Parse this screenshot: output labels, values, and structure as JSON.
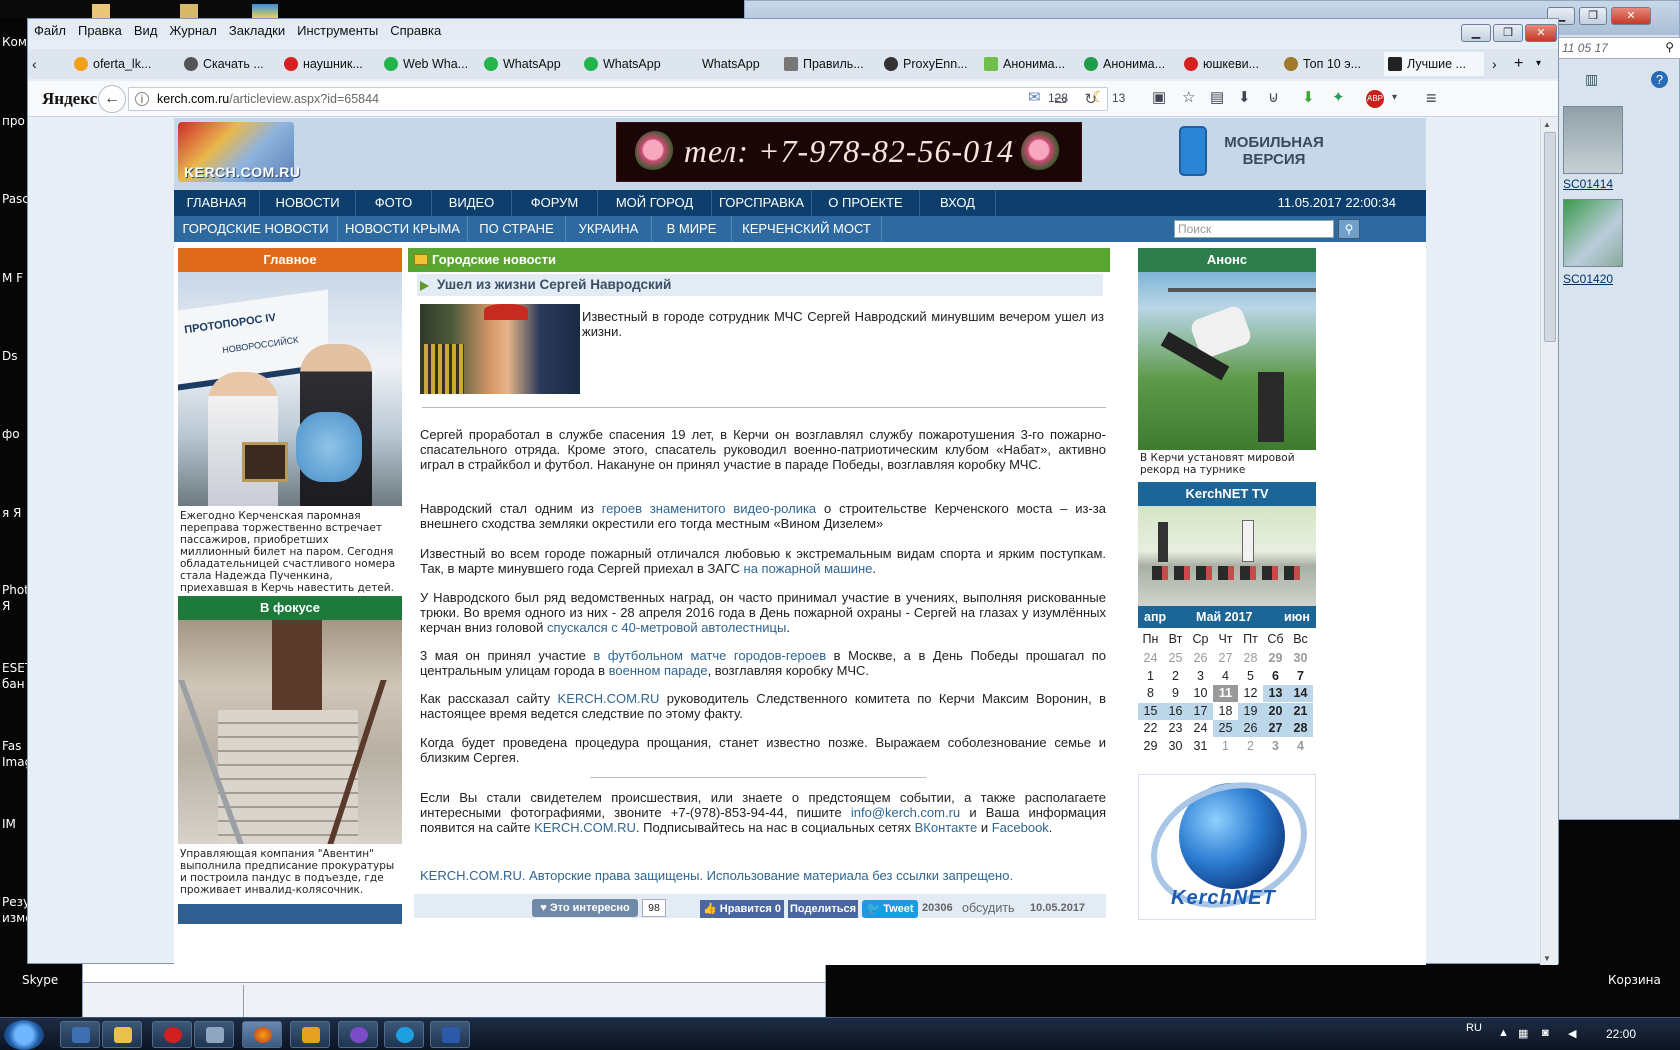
{
  "desktop": {
    "left_icons": [
      "Ком",
      "про",
      "Pasc",
      "М F",
      "Ds",
      "фо",
      "я Я",
      "Phot Я",
      "ESET бан",
      "Fas Imag",
      "IM",
      "Резу изме"
    ],
    "skype_label": "Skype",
    "recycle_label": "Корзина",
    "right_window": {
      "date_text": "11 05 17",
      "thumb1_caption": "SC01414",
      "thumb2_caption": "SC01420"
    }
  },
  "browser": {
    "menu": [
      "Файл",
      "Правка",
      "Вид",
      "Журнал",
      "Закладки",
      "Инструменты",
      "Справка"
    ],
    "tabs": [
      {
        "label": "oferta_lk...",
        "icon_color": "#f2a01a"
      },
      {
        "label": "Скачать ...",
        "icon_color": "#555555"
      },
      {
        "label": "наушник...",
        "icon_color": "#d62020"
      },
      {
        "label": "Web Wha...",
        "icon_color": "#25b34b"
      },
      {
        "label": "WhatsApp",
        "icon_color": "#25b34b"
      },
      {
        "label": "WhatsApp",
        "icon_color": "#25b34b"
      },
      {
        "label": "WhatsApp",
        "icon_color": "#dde5ef"
      },
      {
        "label": "Правиль...",
        "icon_color": "#777777"
      },
      {
        "label": "ProxyEnn...",
        "icon_color": "#333333"
      },
      {
        "label": "Анонима...",
        "icon_color": "#6fbf4a"
      },
      {
        "label": "Анонима...",
        "icon_color": "#1f9d4a"
      },
      {
        "label": "юшкеви...",
        "icon_color": "#d62020"
      },
      {
        "label": "Топ 10 э...",
        "icon_color": "#a07a2a"
      },
      {
        "label": "Лучшие ...",
        "icon_color": "#222222"
      }
    ],
    "yandex_logo": "Яндекс",
    "url_host": "kerch.com.ru",
    "url_path": "/articleview.aspx?id=65844",
    "mail_count": "128",
    "weather_count": "13"
  },
  "site": {
    "logo_text": "KERCH.COM.RU",
    "phone_banner": "тел: +7-978-82-56-014",
    "mobile_line1": "МОБИЛЬНАЯ",
    "mobile_line2": "ВЕРСИЯ",
    "nav1": [
      "ГЛАВНАЯ",
      "НОВОСТИ",
      "ФОТО",
      "ВИДЕО",
      "ФОРУМ",
      "МОЙ ГОРОД",
      "ГОРСПРАВКА",
      "О ПРОЕКТЕ",
      "ВХОД"
    ],
    "datetime": "11.05.2017 22:00:34",
    "nav2": [
      "ГОРОДСКИЕ НОВОСТИ",
      "НОВОСТИ КРЫМА",
      "ПО СТРАНЕ",
      "УКРАИНА",
      "В МИРЕ",
      "КЕРЧЕНСКИЙ МОСТ"
    ],
    "search_placeholder": "Поиск",
    "left": {
      "main_title": "Главное",
      "main_caption": "Ежегодно Керченская паромная переправа торжественно встречает пассажиров, приобретших миллионный билет на паром. Сегодня обладательницей счастливого номера стала Надежда Пученкина, приехавшая в Керчь навестить детей.",
      "focus_title": "В фокусе",
      "focus_caption": "Управляющая компания \"Авентин\" выполнила предписание прокуратуры и построила пандус в подъезде, где проживает инвалид-колясочник.",
      "ship_text": "ПРОТОПОРОС IV",
      "ship_sub": "НОВОРОССИЙСК"
    },
    "article": {
      "section": "Городские новости",
      "title": "Ушел из жизни Сергей Навродский",
      "lead": "Известный в городе сотрудник МЧС Сергей Навродский минувшим вечером ушел из жизни.",
      "p1": "Сергей проработал в службе спасения 19 лет, в Керчи он возглавлял службу пожаротушения 3-го пожарно-спасательного отряда. Кроме этого, спасатель руководил военно-патриотическим клубом «Набат», активно играл в страйкбол и футбол.  Накануне он принял участие в параде Победы, возглавляя коробку МЧС.",
      "p2a": "Навродский стал одним из ",
      "p2link": "героев знаменитого видео-ролика",
      "p2b": " о строительстве Керченского моста – из-за внешнего сходства земляки окрестили его тогда местным «Вином Дизелем»",
      "p3a": "Известный во всем городе пожарный отличался любовью к экстремальным видам спорта и ярким поступкам. Так, в марте минувшего года Сергей приехал в ЗАГС ",
      "p3link": "на пожарной машине",
      "p3b": ".",
      "p4a": "У Навродского был ряд ведомственных наград, он часто принимал участие в учениях, выполняя рискованные трюки. Во время одного из них - 28 апреля 2016 года в День пожарной охраны - Сергей на глазах у изумлённых керчан вниз головой ",
      "p4link": "спускался с 40-метровой автолестницы",
      "p4b": ".",
      "p5a": "3 мая он принял участие ",
      "p5link1": "в футбольном матче городов-героев",
      "p5b": " в Москве, а в День Победы прошагал по центральным улицам города в ",
      "p5link2": "военном параде",
      "p5c": ", возглавляя коробку МЧС.",
      "p6a": "Как рассказал сайту ",
      "p6link": "KERCH.COM.RU",
      "p6b": " руководитель Следственного комитета по Керчи Максим Воронин, в настоящее время ведется следствие по этому факту.",
      "p7": "Когда будет проведена процедура прощания, станет известно позже. Выражаем соболезнование семье и близким Сергея.",
      "p8a": "Если Вы стали свидетелем происшествия, или знаете о предстоящем событии, а также располагаете интересными фотографиями, звоните +7-(978)-853-94-44, пишите ",
      "p8mail": "info@kerch.com.ru",
      "p8b": " и Ваша информация появится на сайте ",
      "p8site": "KERCH.COM.RU",
      "p8c": ". Подписывайтесь на нас в социальных сетях ",
      "p8vk": "ВКонтакте",
      "p8d": " и ",
      "p8fb": "Facebook",
      "p8e": ".",
      "copyright": "KERCH.COM.RU. Авторские права защищены. Использование материала без ссылки запрещено.",
      "interesting": "Это интересно",
      "interesting_count": "98",
      "like": "Нравится 0",
      "share": "Поделиться",
      "tweet": "Tweet",
      "views": "20306",
      "discuss": "обсудить",
      "date": "10.05.2017"
    },
    "right": {
      "anons_title": "Анонс",
      "anons_caption": "В Керчи установят мировой рекорд на турнике",
      "tv_title": "KerchNET TV",
      "logo_text": "KerchNET",
      "calendar": {
        "prev": "апр",
        "month": "Май 2017",
        "next": "июн",
        "weekdays": [
          "Пн",
          "Вт",
          "Ср",
          "Чт",
          "Пт",
          "Сб",
          "Вс"
        ],
        "rows": [
          [
            "24",
            "25",
            "26",
            "27",
            "28",
            "29",
            "30"
          ],
          [
            "1",
            "2",
            "3",
            "4",
            "5",
            "6",
            "7"
          ],
          [
            "8",
            "9",
            "10",
            "11",
            "12",
            "13",
            "14"
          ],
          [
            "15",
            "16",
            "17",
            "18",
            "19",
            "20",
            "21"
          ],
          [
            "22",
            "23",
            "24",
            "25",
            "26",
            "27",
            "28"
          ],
          [
            "29",
            "30",
            "31",
            "1",
            "2",
            "3",
            "4"
          ]
        ]
      }
    }
  },
  "taskbar": {
    "lang": "RU",
    "time": "22:00"
  }
}
